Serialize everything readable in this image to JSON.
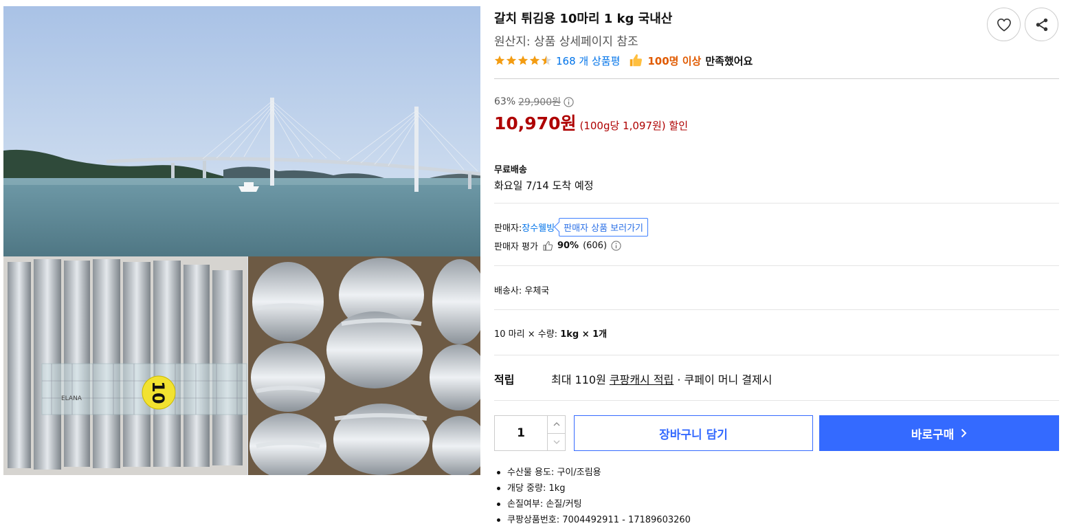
{
  "product": {
    "title": "갈치 튀김용 10마리 1 kg 국내산",
    "origin": "원산지: 상품 상세페이지 참조",
    "rating": 4.5,
    "review_count_text": "168 개 상품평",
    "satisfaction_highlight": "100명 이상",
    "satisfaction_rest": "만족했어요"
  },
  "price": {
    "discount_rate": "63%",
    "original_price": "29,900원",
    "sale_price": "10,970원",
    "unit_price": "(100g당 1,097원) 할인"
  },
  "shipping": {
    "title": "무료배송",
    "arrival": "화요일 7/14 도착 예정"
  },
  "seller": {
    "label": "판매자:",
    "name": "장수웰빙",
    "view_button": "판매자 상품 보러가기",
    "rating_label": "판매자 평가",
    "rating_percent": "90%",
    "rating_count": "(606)"
  },
  "carrier": {
    "text": "배송사:  우체국"
  },
  "option": {
    "prefix": "10 마리 × 수량: ",
    "bold": "1kg × 1개"
  },
  "reward": {
    "label": "적립",
    "prefix": "최대 110원 ",
    "link": "쿠팡캐시 적립",
    "suffix": " · 쿠페이 머니 결제시"
  },
  "purchase": {
    "quantity": "1",
    "cart_label": "장바구니 담기",
    "buy_label": "바로구매"
  },
  "attributes": [
    "수산물 용도: 구이/조림용",
    "개당 중량: 1kg",
    "손질여부: 손질/커팅",
    "쿠팡상품번호: 7004492911 - 17189603260"
  ],
  "image": {
    "tag_text": "10",
    "ruler_text": "ELANA"
  },
  "icons": {
    "wishlist": "heart-icon",
    "share": "share-icon",
    "info": "info-icon",
    "thumbs_up": "thumbs-up-icon",
    "buy_arrow": "chevron-right-icon"
  },
  "colors": {
    "sale_price": "#ae0000",
    "link": "#0073e9",
    "accent": "#346aff",
    "star": "#f39c12",
    "satisfaction": "#e05a00"
  }
}
